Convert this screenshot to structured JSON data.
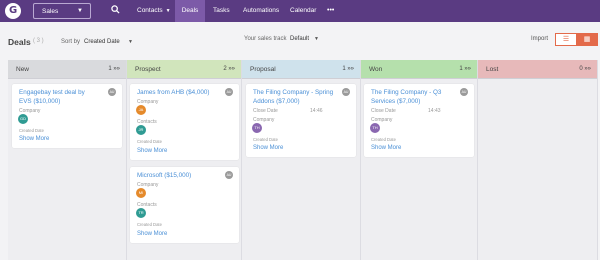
{
  "nav": {
    "logo": "G",
    "selector": "Sales",
    "items": [
      "Contacts",
      "Deals",
      "Tasks",
      "Automations",
      "Calendar"
    ],
    "more": "•••"
  },
  "toolbar": {
    "title": "Deals",
    "count": "( 3 )",
    "sort_label": "Sort by",
    "sort_value": "Created Date",
    "track_label": "Your sales track",
    "track_value": "Default",
    "import": "Import",
    "view_list": "☰",
    "view_board": "▦"
  },
  "colors": {
    "new": "#d9dadd",
    "prospect": "#d1e5bc",
    "proposal": "#cfe2ec",
    "won": "#b5e0ac",
    "lost": "#e7b9ba",
    "badge_orange": "#e58a2b",
    "badge_teal": "#2f9b93",
    "badge_purple": "#8a67b0"
  },
  "columns": {
    "new": {
      "name": "New",
      "count": "1 »»"
    },
    "prospect": {
      "name": "Prospect",
      "count": "2 »»"
    },
    "proposal": {
      "name": "Proposal",
      "count": "1 »»"
    },
    "won": {
      "name": "Won",
      "count": "1 »»"
    },
    "lost": {
      "name": "Lost",
      "count": "0 »»"
    }
  },
  "cards": {
    "engagebay": {
      "title": "Engagebay test deal by EVS ($10,000)",
      "avatar": "AU",
      "company_label": "Company",
      "badge": "GD",
      "created_label": "Created Date",
      "show_more": "Show More"
    },
    "james": {
      "title": "James from AHB ($4,000)",
      "avatar": "AU",
      "company_label": "Company",
      "badge": "JA",
      "contacts_label": "Contacts",
      "contacts_badge": "JR",
      "created_label": "Created Date",
      "show_more": "Show More"
    },
    "microsoft": {
      "title": "Microsoft ($15,000)",
      "avatar": "AU",
      "company_label": "Company",
      "badge": "MI",
      "contacts_label": "Contacts",
      "contacts_badge": "TR",
      "created_label": "Created Date",
      "show_more": "Show More"
    },
    "filing1": {
      "title": "The Filing Company - Spring Addons ($7,000)",
      "avatar": "AU",
      "close_label": "Close Date",
      "close_time": "14:46",
      "company_label": "Company",
      "badge": "TH",
      "created_label": "Created Date",
      "show_more": "Show More"
    },
    "filing2": {
      "title": "The Filing Company - Q3 Services ($7,000)",
      "avatar": "AU",
      "close_label": "Close Date",
      "close_time": "14:43",
      "company_label": "Company",
      "badge": "TH",
      "created_label": "Created Date",
      "show_more": "Show More"
    }
  }
}
